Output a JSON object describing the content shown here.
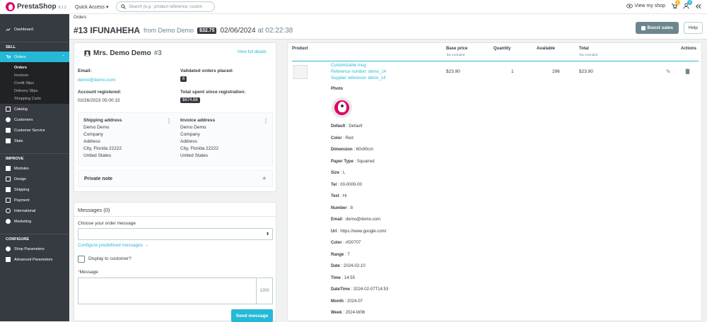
{
  "topbar": {
    "brand": "PrestaShop",
    "version": "8.1.2",
    "quick_access": "Quick Access",
    "search_placeholder": "Search (e.g.: product reference, custon",
    "view_shop": "View my shop",
    "notif_counts": [
      "1",
      "8"
    ]
  },
  "sidebar": {
    "dashboard": "Dashboard",
    "sell": "SELL",
    "orders": "Orders",
    "orders_sub": [
      "Orders",
      "Invoices",
      "Credit Slips",
      "Delivery Slips",
      "Shopping Carts"
    ],
    "sell_items": [
      "Catalog",
      "Customers",
      "Customer Service",
      "Stats"
    ],
    "improve": "IMPROVE",
    "improve_items": [
      "Modules",
      "Design",
      "Shipping",
      "Payment",
      "International",
      "Marketing"
    ],
    "configure": "CONFIGURE",
    "configure_items": [
      "Shop Parameters",
      "Advanced Parameters"
    ]
  },
  "header": {
    "breadcrumb": "Orders",
    "order_ref": "#13 IFUNAHEHA",
    "from": "from Demo Demo",
    "total": "$32.75",
    "date": "02/06/2024",
    "at": "at 02:22:38",
    "boost": "Boost sales",
    "help": "Help"
  },
  "customer": {
    "name": "Mrs. Demo Demo",
    "id": "#3",
    "view_full": "View full details",
    "email_label": "Email:",
    "email": "demo@demo.com",
    "registered_label": "Account registered:",
    "registered": "02/26/2023 05:00:15",
    "validated_label": "Validated orders placed:",
    "validated": "6",
    "spent_label": "Total spent since registration:",
    "spent": "$674.88",
    "shipping_title": "Shipping address",
    "shipping_lines": [
      "Demo Demo",
      "Company",
      "Address",
      "City, Florida 22222",
      "United States"
    ],
    "invoice_title": "Invoice address",
    "invoice_lines": [
      "Demo Demo",
      "Company",
      "Address",
      "City, Florida 22222",
      "United States"
    ],
    "private_note": "Private note"
  },
  "messages": {
    "title": "Messages (0)",
    "choose": "Choose your order message",
    "configure": "Configure predefined messages",
    "display": "Display to customer?",
    "message_label": "*Message",
    "counter": "1200",
    "send": "Send message"
  },
  "products": {
    "headers": {
      "product": "Product",
      "base_price": "Base price",
      "base_price_note": "Tax excluded",
      "quantity": "Quantity",
      "available": "Available",
      "total": "Total",
      "total_note": "Tax excluded",
      "actions": "Actions"
    },
    "row": {
      "name": "Customizable mug",
      "reference": "Reference number: demo_14",
      "supplier": "Supplier reference: demo_14",
      "price": "$23.90",
      "quantity": "1",
      "available": "296",
      "total": "$23.90"
    },
    "photo_label": "Photo",
    "attributes": [
      {
        "k": "Default",
        "v": "Default"
      },
      {
        "k": "Color",
        "v": "Red"
      },
      {
        "k": "Dimension",
        "v": "60x90cm"
      },
      {
        "k": "Paper Type",
        "v": "Squarred"
      },
      {
        "k": "Size",
        "v": "L"
      },
      {
        "k": "Tel",
        "v": "00-0000-00"
      },
      {
        "k": "Text",
        "v": "Hi"
      },
      {
        "k": "Number",
        "v": "8"
      },
      {
        "k": "Email",
        "v": "demo@demo.com"
      },
      {
        "k": "Url",
        "v": "https://www.google.com/"
      },
      {
        "k": "Color",
        "v": "#f20707"
      },
      {
        "k": "Range",
        "v": "7"
      },
      {
        "k": "Date",
        "v": "2024-02-10"
      },
      {
        "k": "Time",
        "v": "14:55"
      },
      {
        "k": "DateTime",
        "v": "2024-02-07T14:53"
      },
      {
        "k": "Month",
        "v": "2024-07"
      },
      {
        "k": "Week",
        "v": "2024-W06"
      }
    ]
  }
}
